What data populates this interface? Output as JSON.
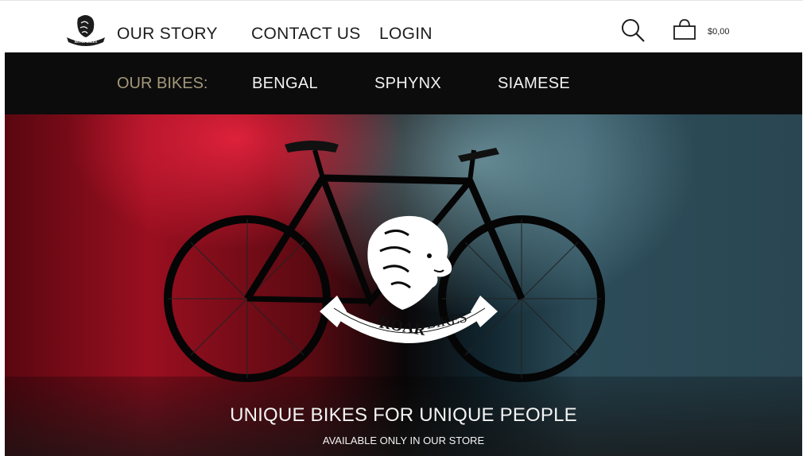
{
  "header": {
    "logo_text": "ROAR BIKES",
    "nav": [
      {
        "label": "OUR STORY"
      },
      {
        "label": "CONTACT US"
      },
      {
        "label": "LOGIN"
      }
    ],
    "cart_total": "$0,00",
    "icons": [
      "search-icon",
      "cart-icon"
    ]
  },
  "categories": {
    "label": "OUR BIKES:",
    "items": [
      "BENGAL",
      "SPHYNX",
      "SIAMESE"
    ],
    "label_color": "#a5987b"
  },
  "hero": {
    "brand_word1": "ROAR",
    "brand_word2": "BIKES",
    "tagline": "UNIQUE BIKES FOR UNIQUE PEOPLE",
    "subtagline": "AVAILABLE ONLY IN OUR STORE"
  }
}
